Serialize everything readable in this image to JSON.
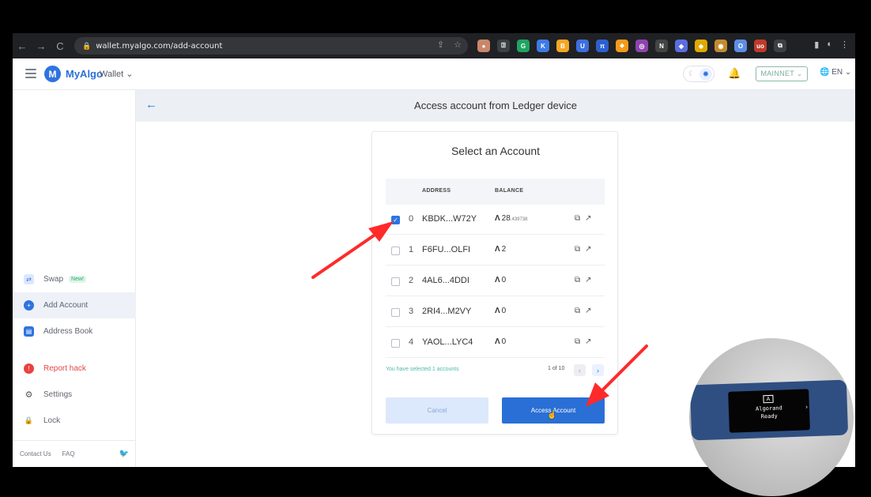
{
  "browser": {
    "url": "wallet.myalgo.com/add-account",
    "nav": {
      "back": "←",
      "forward": "→",
      "reload": "C"
    },
    "extensions": [
      {
        "label": "●",
        "color": "#c9876a"
      },
      {
        "label": "ꖸ",
        "color": "#3c4043"
      },
      {
        "label": "G",
        "color": "#1fa463"
      },
      {
        "label": "K",
        "color": "#3d7be6"
      },
      {
        "label": "B",
        "color": "#f5a623"
      },
      {
        "label": "U",
        "color": "#3d6fe0"
      },
      {
        "label": "π",
        "color": "#2d5fd0"
      },
      {
        "label": "⬥",
        "color": "#f29a1a"
      },
      {
        "label": "◎",
        "color": "#8e44ad"
      },
      {
        "label": "N",
        "color": "#444"
      },
      {
        "label": "◆",
        "color": "#5b6ee1"
      },
      {
        "label": "◈",
        "color": "#e0a800"
      },
      {
        "label": "◉",
        "color": "#c38b2e"
      },
      {
        "label": "O",
        "color": "#5d8de6"
      },
      {
        "label": "uo",
        "color": "#c0392b"
      },
      {
        "label": "⧉",
        "color": "#3c4043"
      }
    ]
  },
  "header": {
    "logo_letter": "M",
    "app_name": "MyAlgo",
    "wallet_label": "Wallet ⌄",
    "theme_moon": "☾",
    "theme_sun": "✹",
    "bell": "🔔",
    "network": "MAINNET ⌄",
    "language": "🌐 EN ⌄"
  },
  "sidebar": {
    "items": [
      {
        "label": "Swap",
        "icon": "⇄",
        "icon_color": "#dbe7ff",
        "icon_fg": "#2f73e0",
        "badge": "New!"
      },
      {
        "label": "Add Account",
        "icon": "+",
        "icon_color": "#2f73e0",
        "icon_fg": "#fff"
      },
      {
        "label": "Address Book",
        "icon": "▤",
        "icon_color": "#2f73e0",
        "icon_fg": "#fff"
      },
      {
        "label": "Report hack",
        "icon": "!",
        "icon_color": "#e94141",
        "icon_fg": "#fff"
      },
      {
        "label": "Settings",
        "icon": "⚙",
        "icon_color": "#ffffff",
        "icon_fg": "#555"
      },
      {
        "label": "Lock",
        "icon": "🔒",
        "icon_color": "#ffffff",
        "icon_fg": "#555"
      }
    ],
    "footer": {
      "contact": "Contact Us",
      "faq": "FAQ",
      "twitter": "🐦"
    }
  },
  "main": {
    "back_icon": "←",
    "subtitle": "Access account from Ledger device",
    "card_title": "Select an Account",
    "columns": {
      "address": "ADDRESS",
      "balance": "BALANCE"
    },
    "rows": [
      {
        "index": "0",
        "address": "KBDK...W72Y",
        "balance": "28",
        "balance_small": ".439738",
        "checked": true
      },
      {
        "index": "1",
        "address": "F6FU...OLFI",
        "balance": "2",
        "balance_small": "",
        "checked": false
      },
      {
        "index": "2",
        "address": "4AL6...4DDI",
        "balance": "0",
        "balance_small": "",
        "checked": false
      },
      {
        "index": "3",
        "address": "2RI4...M2VY",
        "balance": "0",
        "balance_small": "",
        "checked": false
      },
      {
        "index": "4",
        "address": "YAOL...LYC4",
        "balance": "0",
        "balance_small": "",
        "checked": false
      }
    ],
    "selected_text": "You have selected 1 accounts",
    "pager": "1 of 10",
    "cancel_label": "Cancel",
    "access_label": "Access Account"
  },
  "ledger": {
    "line1": "Algorand",
    "line2": "Ready"
  },
  "colors": {
    "accent": "#2a6fd6",
    "arrow": "#ff2a2a"
  }
}
